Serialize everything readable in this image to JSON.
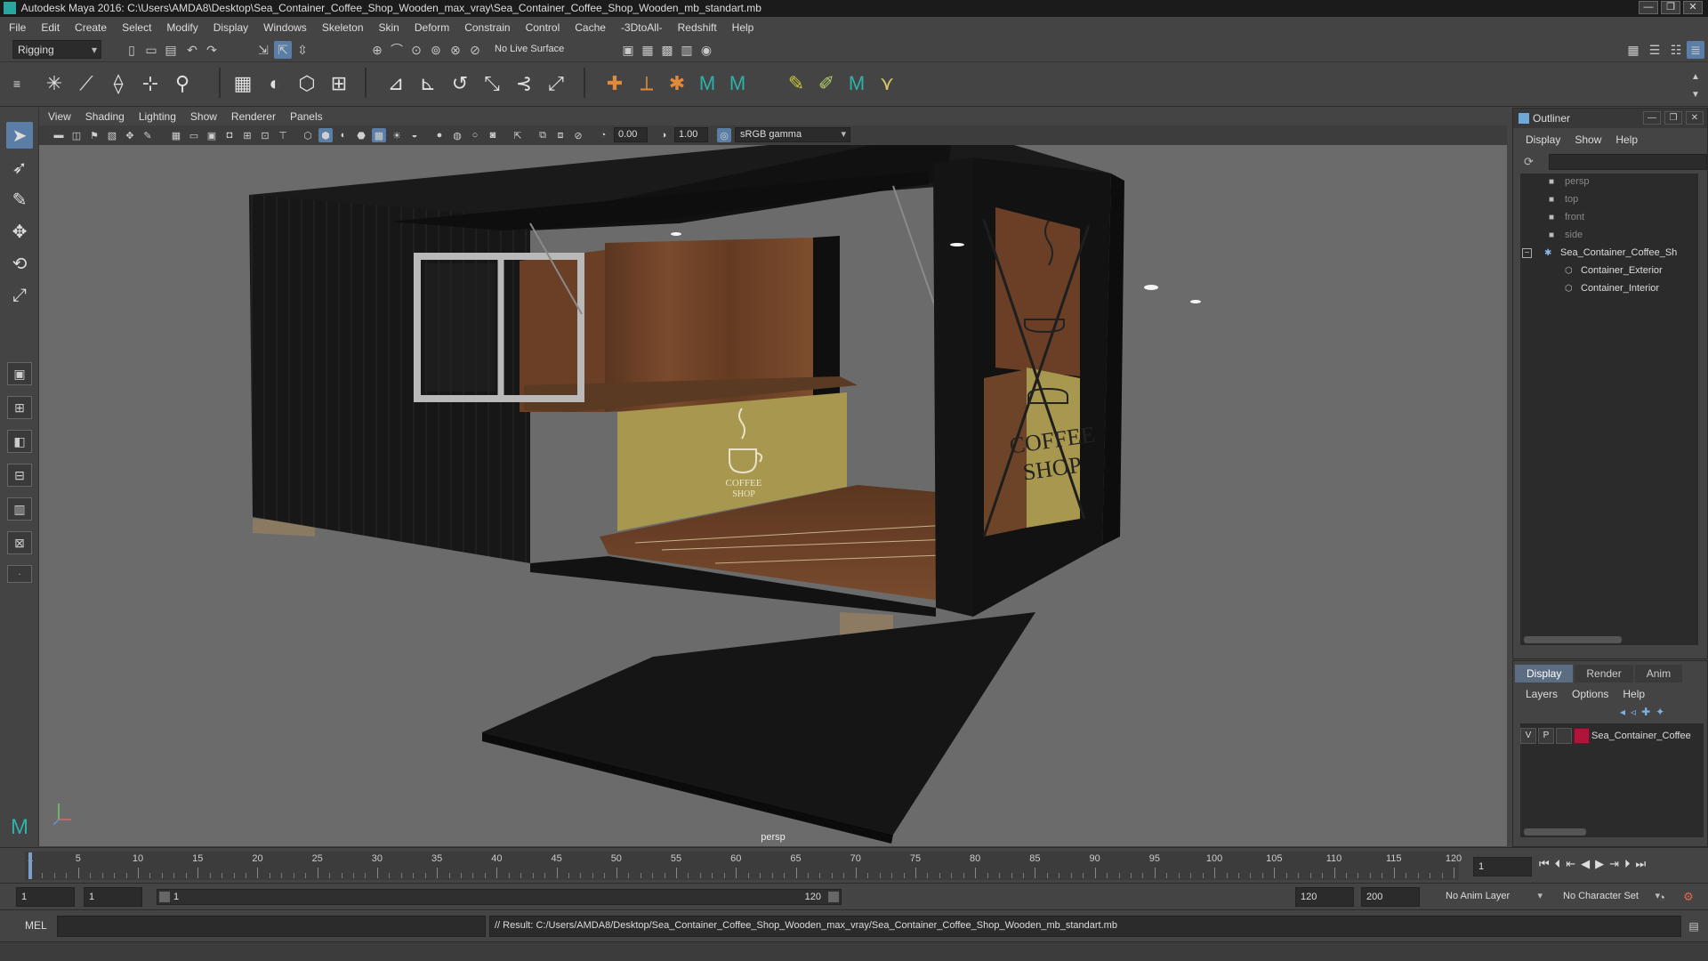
{
  "window": {
    "title": "Autodesk Maya 2016: C:\\Users\\AMDA8\\Desktop\\Sea_Container_Coffee_Shop_Wooden_max_vray\\Sea_Container_Coffee_Shop_Wooden_mb_standart.mb",
    "controls": [
      "—",
      "❐",
      "✕"
    ]
  },
  "menubar": [
    "File",
    "Edit",
    "Create",
    "Select",
    "Modify",
    "Display",
    "Windows",
    "Skeleton",
    "Skin",
    "Deform",
    "Constrain",
    "Control",
    "Cache",
    "-3DtoAll-",
    "Redshift",
    "Help"
  ],
  "statusline": {
    "menu_set": "Rigging",
    "live_surface": "No Live Surface"
  },
  "panel": {
    "menus": [
      "View",
      "Shading",
      "Lighting",
      "Show",
      "Renderer",
      "Panels"
    ],
    "exposure": "0.00",
    "gamma": "1.00",
    "color_space": "sRGB gamma",
    "camera_label": "persp"
  },
  "scene": {
    "counter_sign_line1": "COFFEE",
    "counter_sign_line2": "SHOP",
    "side_sign_line1": "COFFEE",
    "side_sign_line2": "SHOP"
  },
  "outliner": {
    "title": "Outliner",
    "menus": [
      "Display",
      "Show",
      "Help"
    ],
    "cameras": [
      "persp",
      "top",
      "front",
      "side"
    ],
    "root_node": "Sea_Container_Coffee_Sh",
    "children": [
      "Container_Exterior",
      "Container_Interior"
    ]
  },
  "layer_editor": {
    "tabs": [
      "Display",
      "Render",
      "Anim"
    ],
    "active_tab": "Display",
    "menus": [
      "Layers",
      "Options",
      "Help"
    ],
    "layer": {
      "v": "V",
      "p": "P",
      "name": "Sea_Container_Coffee",
      "color": "#b0143a"
    }
  },
  "timeline": {
    "labels": [
      "1",
      "5",
      "10",
      "15",
      "20",
      "25",
      "30",
      "35",
      "40",
      "45",
      "50",
      "55",
      "60",
      "65",
      "70",
      "75",
      "80",
      "85",
      "90",
      "95",
      "100",
      "105",
      "110",
      "115",
      "120"
    ],
    "min": 1,
    "max": 120,
    "current_frame": "1"
  },
  "range": {
    "start": "1",
    "anim_start": "1",
    "slider_start": "1",
    "slider_end": "120",
    "playback_end": "120",
    "anim_end": "200",
    "anim_layer": "No Anim Layer",
    "character_set": "No Character Set"
  },
  "command": {
    "language": "MEL",
    "result": "// Result: C:/Users/AMDA8/Desktop/Sea_Container_Coffee_Shop_Wooden_max_vray/Sea_Container_Coffee_Shop_Wooden_mb_standart.mb"
  },
  "colors": {
    "accent": "#5b7ea7",
    "container": "#151515",
    "wood": "#6b4128",
    "counter": "#a7974f",
    "viewport_bg": "#6b6b6b"
  }
}
